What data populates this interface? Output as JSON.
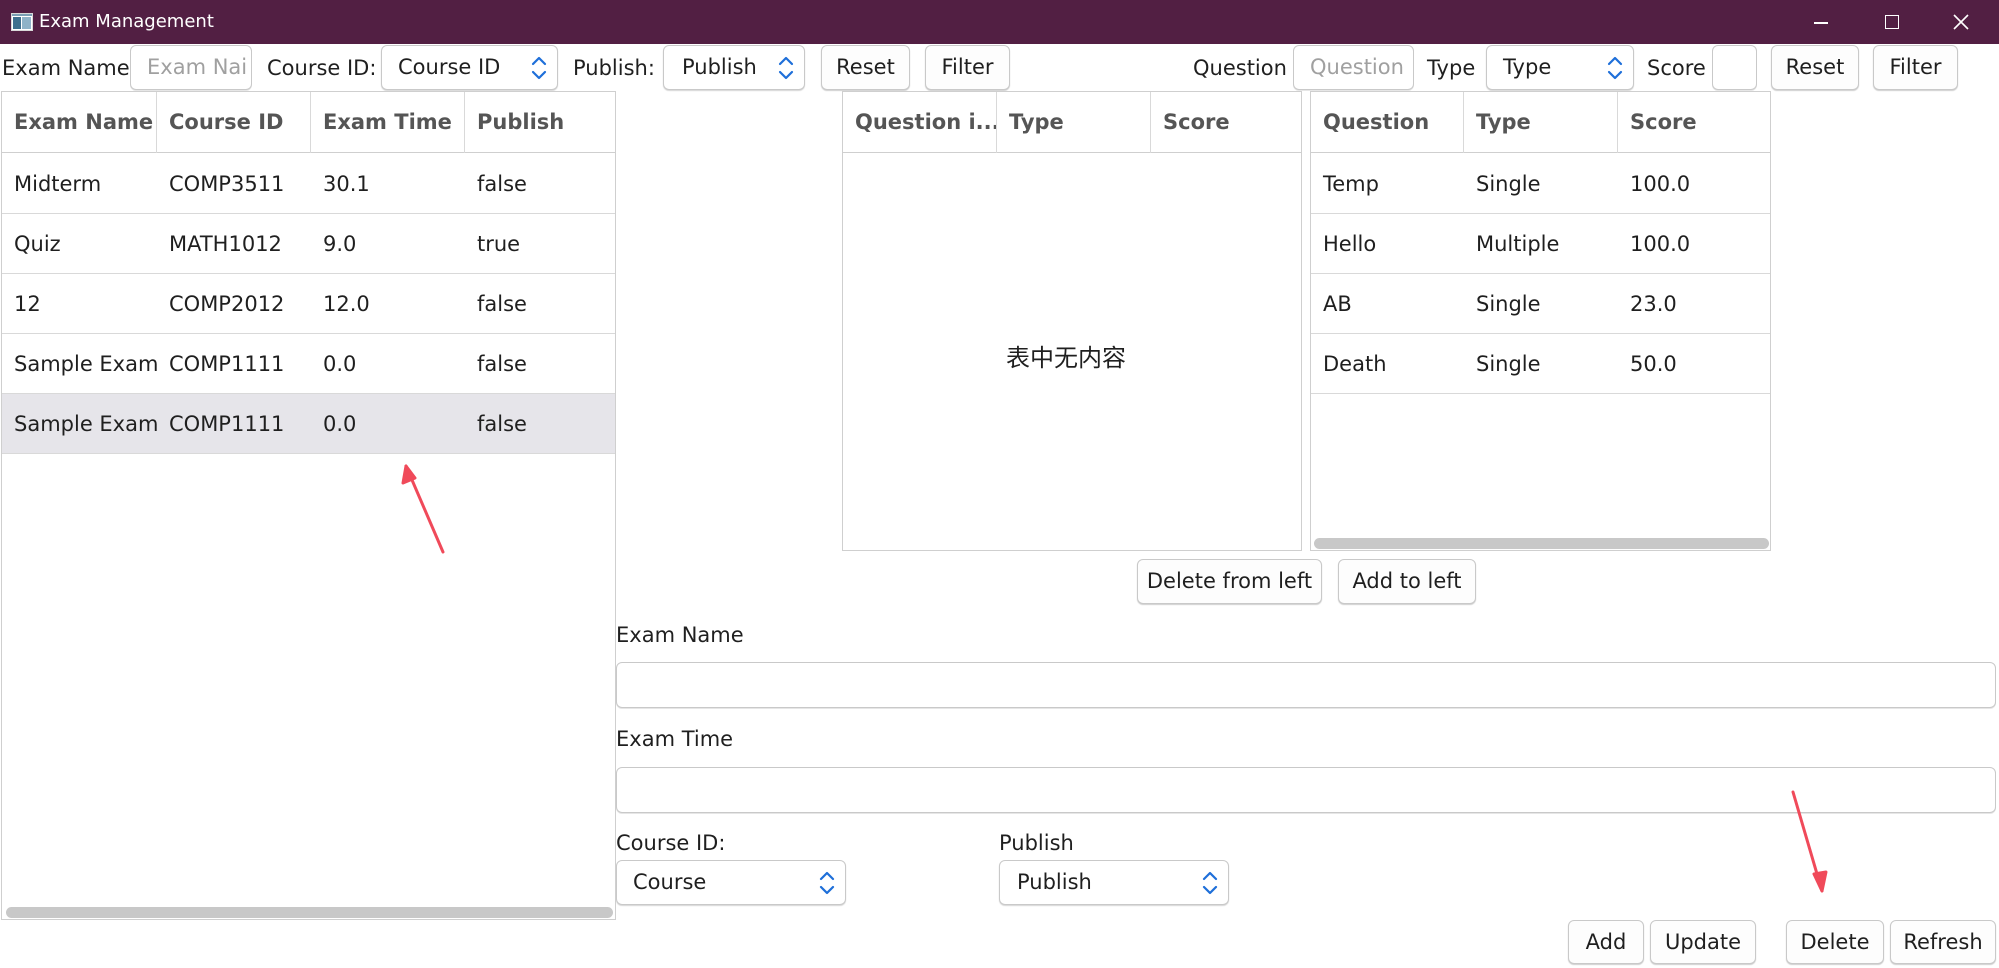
{
  "window": {
    "title": "Exam Management"
  },
  "filters_left": {
    "exam_name_label": "Exam Name",
    "exam_name_placeholder": "Exam Nai",
    "course_id_label": "Course ID:",
    "course_id_value": "Course ID",
    "publish_label": "Publish:",
    "publish_value": "Publish",
    "reset": "Reset",
    "filter": "Filter"
  },
  "filters_right": {
    "question_label": "Question",
    "question_placeholder": "Question",
    "type_label": "Type",
    "type_value": "Type",
    "score_label": "Score",
    "score_value": "",
    "reset": "Reset",
    "filter": "Filter"
  },
  "exam_table": {
    "columns": [
      "Exam Name",
      "Course ID",
      "Exam Time",
      "Publish"
    ],
    "rows": [
      [
        "Midterm",
        "COMP3511",
        "30.1",
        "false"
      ],
      [
        "Quiz",
        "MATH1012",
        "9.0",
        "true"
      ],
      [
        "12",
        "COMP2012",
        "12.0",
        "false"
      ],
      [
        "Sample Exam",
        "COMP1111",
        "0.0",
        "false"
      ],
      [
        "Sample Exam",
        "COMP1111",
        "0.0",
        "false"
      ]
    ],
    "selected_row": 4
  },
  "exam_questions_table": {
    "columns": [
      "Question i...",
      "Type",
      "Score"
    ],
    "empty_message": "表中无内容"
  },
  "question_table": {
    "columns": [
      "Question",
      "Type",
      "Score"
    ],
    "rows": [
      [
        "Temp",
        "Single",
        "100.0"
      ],
      [
        "Hello",
        "Multiple",
        "100.0"
      ],
      [
        "AB",
        "Single",
        "23.0"
      ],
      [
        "Death",
        "Single",
        "50.0"
      ]
    ]
  },
  "transfer": {
    "delete_from_left": "Delete from left",
    "add_to_left": "Add to left"
  },
  "form": {
    "exam_name_label": "Exam Name",
    "exam_name_value": "",
    "exam_time_label": "Exam Time",
    "exam_time_value": "",
    "course_id_label": "Course ID:",
    "course_id_value": "Course",
    "publish_label": "Publish",
    "publish_value": "Publish"
  },
  "actions": {
    "add": "Add",
    "update": "Update",
    "delete": "Delete",
    "refresh": "Refresh"
  },
  "colors": {
    "titlebar": "#521f43",
    "selected_row": "#e6e5ea",
    "annotation_arrow": "#f04a5a",
    "spinner_arrow": "#1e6fd9"
  },
  "icons": [
    "app-icon",
    "minimize-icon",
    "maximize-icon",
    "close-icon",
    "spinner-arrows-icon",
    "annotation-arrow"
  ]
}
